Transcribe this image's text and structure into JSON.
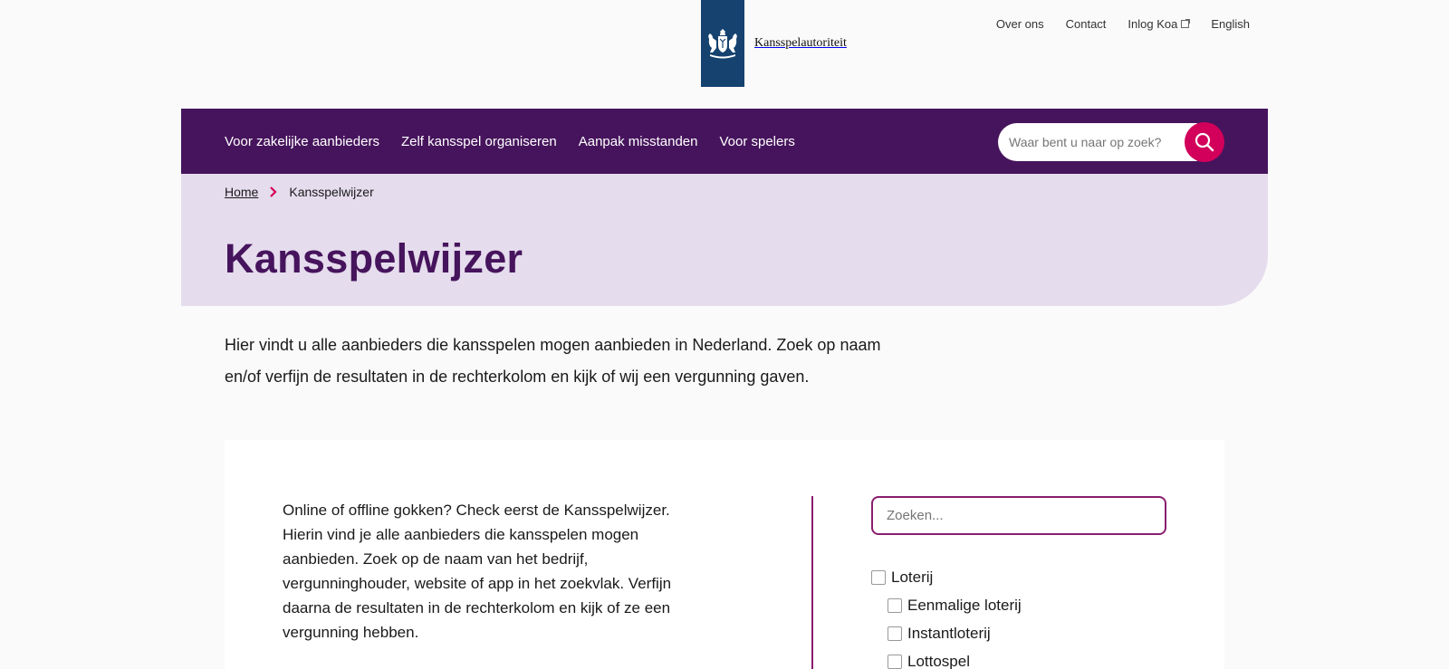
{
  "top_links": [
    {
      "label": "Over ons"
    },
    {
      "label": "Contact"
    },
    {
      "label": "Inlog Koa",
      "external": true
    },
    {
      "label": "English"
    }
  ],
  "logo": {
    "name": "Kansspelautoriteit",
    "icon": "crest-icon"
  },
  "nav": {
    "items": [
      {
        "label": "Voor zakelijke aanbieders"
      },
      {
        "label": "Zelf kansspel organiseren"
      },
      {
        "label": "Aanpak misstanden"
      },
      {
        "label": "Voor spelers"
      }
    ],
    "search_placeholder": "Waar bent u naar op zoek?"
  },
  "breadcrumb": {
    "home": "Home",
    "current": "Kansspelwijzer"
  },
  "page": {
    "title": "Kansspelwijzer",
    "intro": "Hier vindt u alle aanbieders die kansspelen mogen aanbieden in Nederland. Zoek op naam en/of verfijn de resultaten in de rechterkolom en kijk of wij een vergunning gaven."
  },
  "card": {
    "text": "Online of offline gokken? Check eerst de Kansspelwijzer. Hierin vind je alle aanbieders die kansspelen mogen aanbieden. Zoek op de naam van het bedrijf, vergunninghouder, website of app in het zoekvlak. Verfijn daarna de resultaten in de rechterkolom en kijk of ze een vergunning hebben.",
    "search_placeholder": "Zoeken...",
    "filters": [
      {
        "label": "Loterij",
        "checked": false
      },
      {
        "label": "Eenmalige loterij",
        "checked": false
      },
      {
        "label": "Instantloterij",
        "checked": false
      },
      {
        "label": "Lottospel",
        "checked": false
      }
    ]
  },
  "colors": {
    "nav_bg": "#46145c",
    "hero_bg": "#e5dced",
    "accent": "#d2005a",
    "logo_bg": "#15426f",
    "border_accent": "#8a1e6e"
  }
}
